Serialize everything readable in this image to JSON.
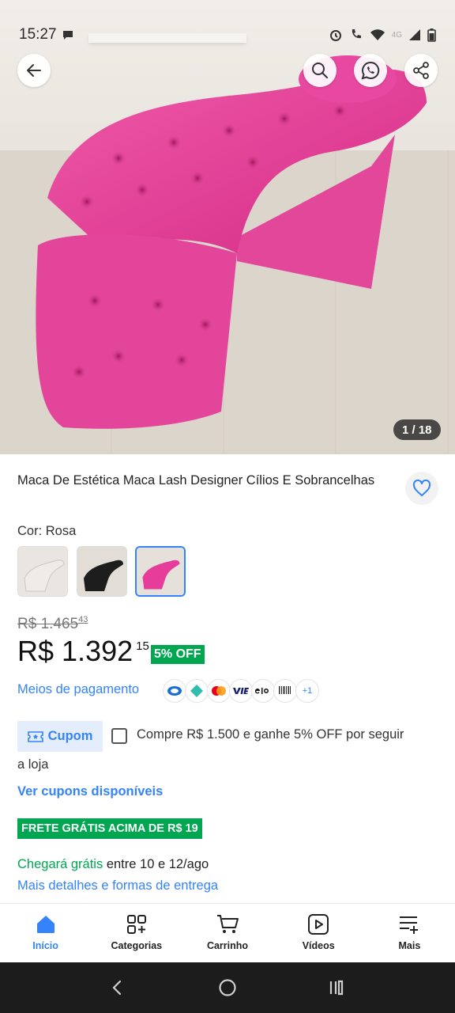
{
  "status_bar": {
    "time": "15:27",
    "network": "4G"
  },
  "gallery": {
    "counter": "1 / 18"
  },
  "product": {
    "title": "Maca De Estética Maca Lash Designer Cílios E Sobrancelhas",
    "color_label": "Cor: Rosa",
    "swatches": [
      {
        "name": "Branco",
        "color": "#efece7"
      },
      {
        "name": "Preto",
        "color": "#1d1d1d"
      },
      {
        "name": "Rosa",
        "color": "#e63d9a",
        "selected": true
      }
    ],
    "old_price": {
      "main": "R$ 1.465",
      "cents": "43"
    },
    "price": {
      "main": "R$ 1.392",
      "cents": "15"
    },
    "discount": "5% OFF",
    "payment_link": "Meios de pagamento",
    "payment_icons": [
      "caixa-icon",
      "pix-icon",
      "mastercard-icon",
      "visa-icon",
      "elo-icon",
      "boleto-icon",
      "+1"
    ],
    "coupon": {
      "tag": "Cupom",
      "text_line1": "Compre R$ 1.500 e ganhe 5% OFF por seguir",
      "text_line2": "a loja",
      "see_all": "Ver cupons disponíveis"
    },
    "shipping": {
      "badge": "FRETE GRÁTIS ACIMA DE R$ 19",
      "arrival_green": "Chegará grátis",
      "arrival_rest": " entre 10 e 12/ago",
      "details_link": "Mais detalhes e formas de entrega"
    }
  },
  "bottom_nav": [
    {
      "label": "Início",
      "icon": "home-icon",
      "active": true
    },
    {
      "label": "Categorias",
      "icon": "categories-icon"
    },
    {
      "label": "Carrinho",
      "icon": "cart-icon"
    },
    {
      "label": "Vídeos",
      "icon": "video-icon"
    },
    {
      "label": "Mais",
      "icon": "more-icon"
    }
  ],
  "colors": {
    "accent": "#3483fa",
    "green": "#00a650",
    "pink": "#e63d9a"
  }
}
